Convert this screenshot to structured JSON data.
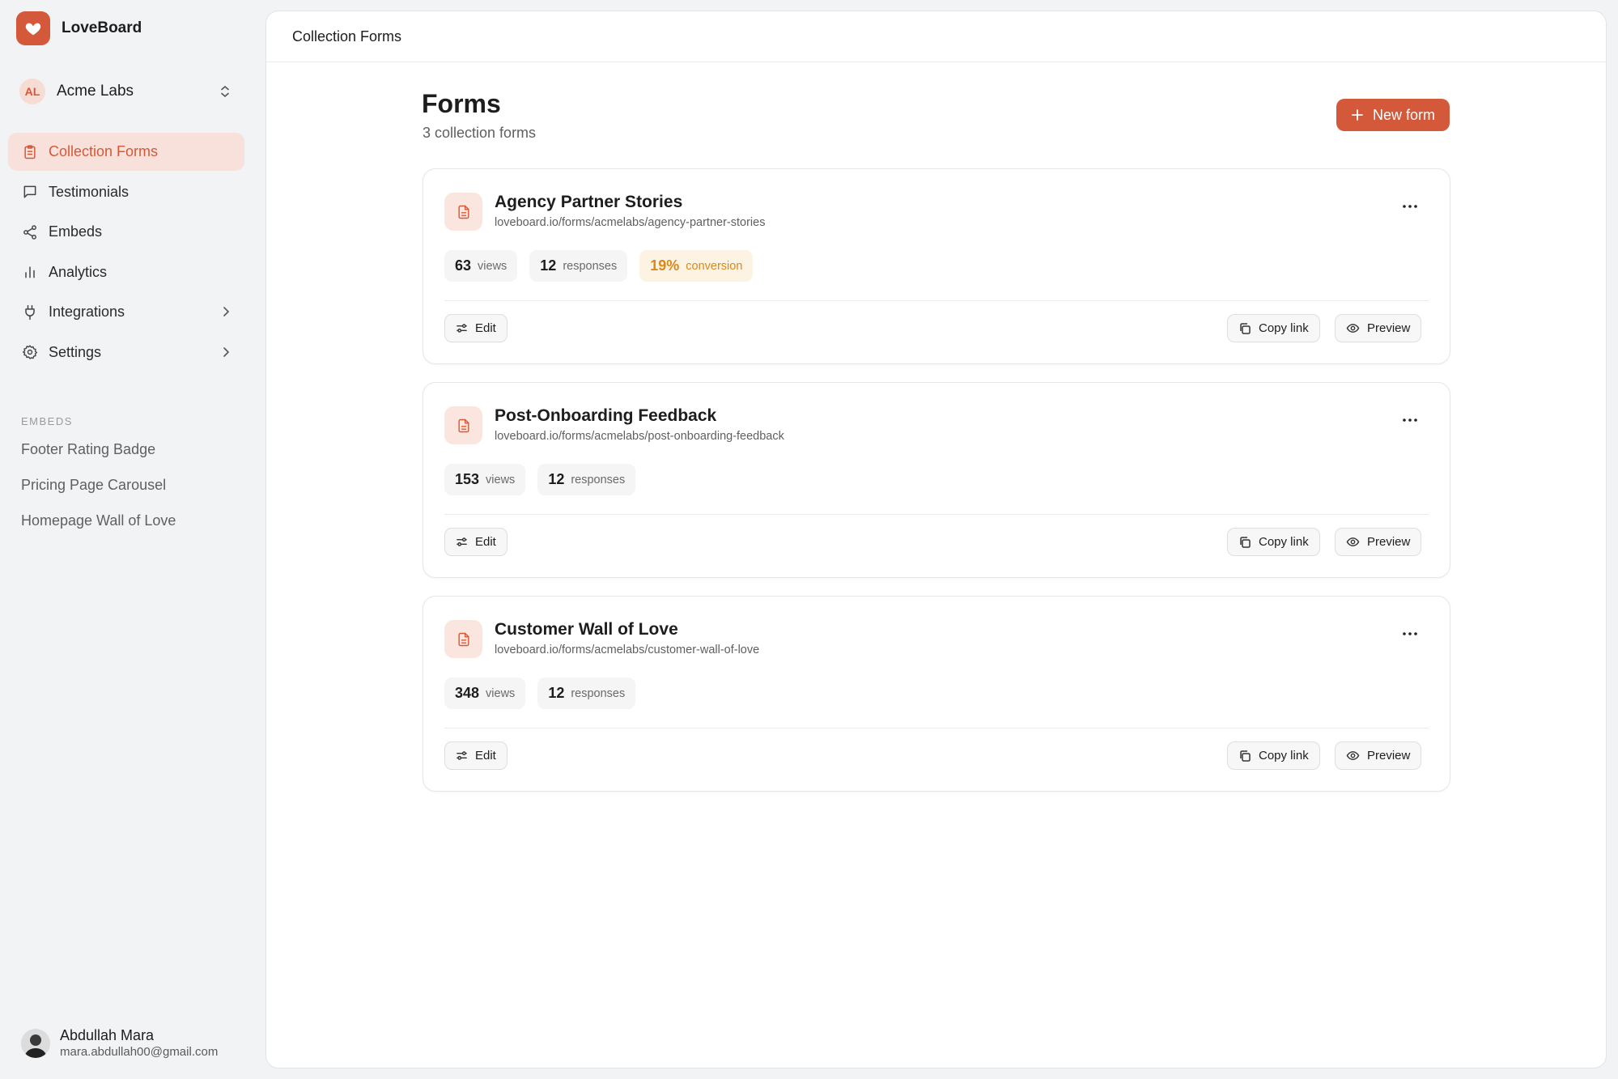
{
  "app": {
    "name": "LoveBoard",
    "accent": "#d4593a"
  },
  "workspace": {
    "initials": "AL",
    "name": "Acme Labs"
  },
  "nav": [
    {
      "label": "Collection Forms",
      "icon": "clipboard-icon",
      "active": true
    },
    {
      "label": "Testimonials",
      "icon": "message-square-icon"
    },
    {
      "label": "Embeds",
      "icon": "share-icon"
    },
    {
      "label": "Analytics",
      "icon": "bar-chart-icon"
    },
    {
      "label": "Integrations",
      "icon": "plug-icon",
      "has_submenu": true
    },
    {
      "label": "Settings",
      "icon": "gear-icon",
      "has_submenu": true
    }
  ],
  "embeds": {
    "heading": "EMBEDS",
    "items": [
      "Footer Rating Badge",
      "Pricing Page Carousel",
      "Homepage Wall of Love"
    ]
  },
  "user": {
    "name": "Abdullah Mara",
    "email": "mara.abdullah00@gmail.com"
  },
  "topbar": {
    "title": "Collection Forms"
  },
  "page": {
    "title": "Forms",
    "subtitle": "3 collection forms",
    "new_button": "New form"
  },
  "forms": [
    {
      "title": "Agency Partner Stories",
      "url": "loveboard.io/forms/acmelabs/agency-partner-stories",
      "stats": [
        {
          "value": "63",
          "label": "views"
        },
        {
          "value": "12",
          "label": "responses"
        },
        {
          "value": "19%",
          "label": "conversion"
        }
      ]
    },
    {
      "title": "Post-Onboarding Feedback",
      "url": "loveboard.io/forms/acmelabs/post-onboarding-feedback",
      "stats": [
        {
          "value": "153",
          "label": "views"
        },
        {
          "value": "12",
          "label": "responses"
        }
      ]
    },
    {
      "title": "Customer Wall of Love",
      "url": "loveboard.io/forms/acmelabs/customer-wall-of-love",
      "stats": [
        {
          "value": "348",
          "label": "views"
        },
        {
          "value": "12",
          "label": "responses"
        }
      ]
    }
  ],
  "card_actions": {
    "edit": "Edit",
    "copy": "Copy link",
    "preview": "Preview"
  }
}
